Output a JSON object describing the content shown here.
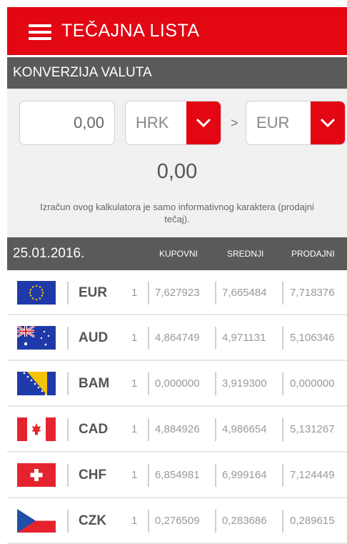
{
  "app": {
    "title": "TEČAJNA LISTA"
  },
  "converter": {
    "section_title": "KONVERZIJA VALUTA",
    "amount": "0,00",
    "from_currency": "HRK",
    "separator": ">",
    "to_currency": "EUR",
    "result": "0,00",
    "note": "Izračun ovog kalkulatora je samo informativnog karaktera (prodajni tečaj)."
  },
  "table": {
    "date": "25.01.2016.",
    "columns": {
      "buy": "KUPOVNI",
      "mid": "SREDNJI",
      "sell": "PRODAJNI"
    },
    "rows": [
      {
        "code": "EUR",
        "unit": "1",
        "buy": "7,627923",
        "mid": "7,665484",
        "sell": "7,718376",
        "flag": "eu-flag-icon"
      },
      {
        "code": "AUD",
        "unit": "1",
        "buy": "4,864749",
        "mid": "4,971131",
        "sell": "5,106346",
        "flag": "australia-flag-icon"
      },
      {
        "code": "BAM",
        "unit": "1",
        "buy": "0,000000",
        "mid": "3,919300",
        "sell": "0,000000",
        "flag": "bosnia-flag-icon"
      },
      {
        "code": "CAD",
        "unit": "1",
        "buy": "4,884926",
        "mid": "4,986654",
        "sell": "5,131267",
        "flag": "canada-flag-icon"
      },
      {
        "code": "CHF",
        "unit": "1",
        "buy": "6,854981",
        "mid": "6,999164",
        "sell": "7,124449",
        "flag": "switzerland-flag-icon"
      },
      {
        "code": "CZK",
        "unit": "1",
        "buy": "0,276509",
        "mid": "0,283686",
        "sell": "0,289615",
        "flag": "czech-flag-icon"
      }
    ]
  },
  "colors": {
    "accent": "#e30613",
    "header_gray": "#5a5a5a"
  }
}
